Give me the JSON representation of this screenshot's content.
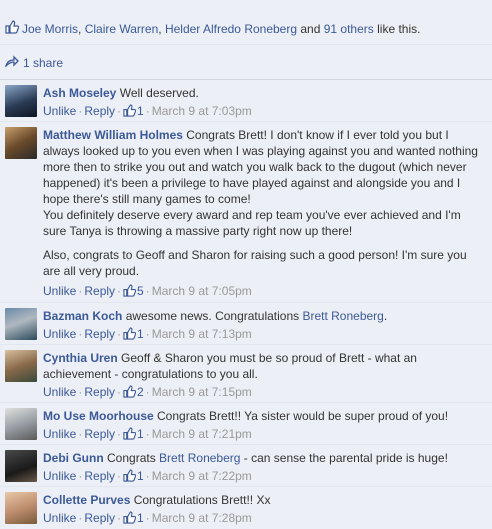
{
  "likes": {
    "names": [
      "Joe Morris",
      "Claire Warren",
      "Helder Alfredo Roneberg"
    ],
    "sep1": ", ",
    "sep2": ", ",
    "and_text": " and ",
    "others": "91 others",
    "suffix": " like this."
  },
  "share": {
    "label": "1 share"
  },
  "actions": {
    "unlike": "Unlike",
    "reply": "Reply",
    "dot": "·"
  },
  "colors": {
    "link": "#3b5998",
    "panel": "#eceff5",
    "muted": "#999999"
  },
  "comments": [
    {
      "author": "Ash Moseley",
      "text": "Well deserved.",
      "likes": "1",
      "time": "March 9 at 7:03pm"
    },
    {
      "author": "Matthew William Holmes",
      "text": "Congrats Brett! I don't know if I ever told you but I always looked up to you even when I was playing against you and wanted nothing more then to strike you out and watch you walk back to the dugout (which never happened) it's been a privilege to have played against and alongside you and I hope there's still many games to come!",
      "text2": "You definitely deserve every award and rep team you've ever achieved and I'm sure Tanya is throwing a massive party right now up there!",
      "text3": "Also, congrats to Geoff and Sharon for raising such a good person! I'm sure you are all very proud.",
      "likes": "5",
      "time": "March 9 at 7:05pm"
    },
    {
      "author": "Bazman Koch",
      "text": "awesome news. Congratulations ",
      "mention": "Brett Roneberg",
      "after": ".",
      "likes": "1",
      "time": "March 9 at 7:13pm"
    },
    {
      "author": "Cynthia Uren",
      "text": "Geoff & Sharon you must be so proud of Brett - what an achievement - congratulations to you all.",
      "likes": "2",
      "time": "March 9 at 7:15pm"
    },
    {
      "author": "Mo Use Moorhouse",
      "text": "Congrats Brett!! Ya sister would be super proud of you!",
      "likes": "1",
      "time": "March 9 at 7:21pm"
    },
    {
      "author": "Debi Gunn",
      "text": "Congrats ",
      "mention": "Brett Roneberg",
      "after": " - can sense the parental pride is huge!",
      "likes": "1",
      "time": "March 9 at 7:22pm"
    },
    {
      "author": "Collette Purves",
      "text": "Congratulations Brett!! Xx",
      "likes": "1",
      "time": "March 9 at 7:28pm"
    }
  ]
}
